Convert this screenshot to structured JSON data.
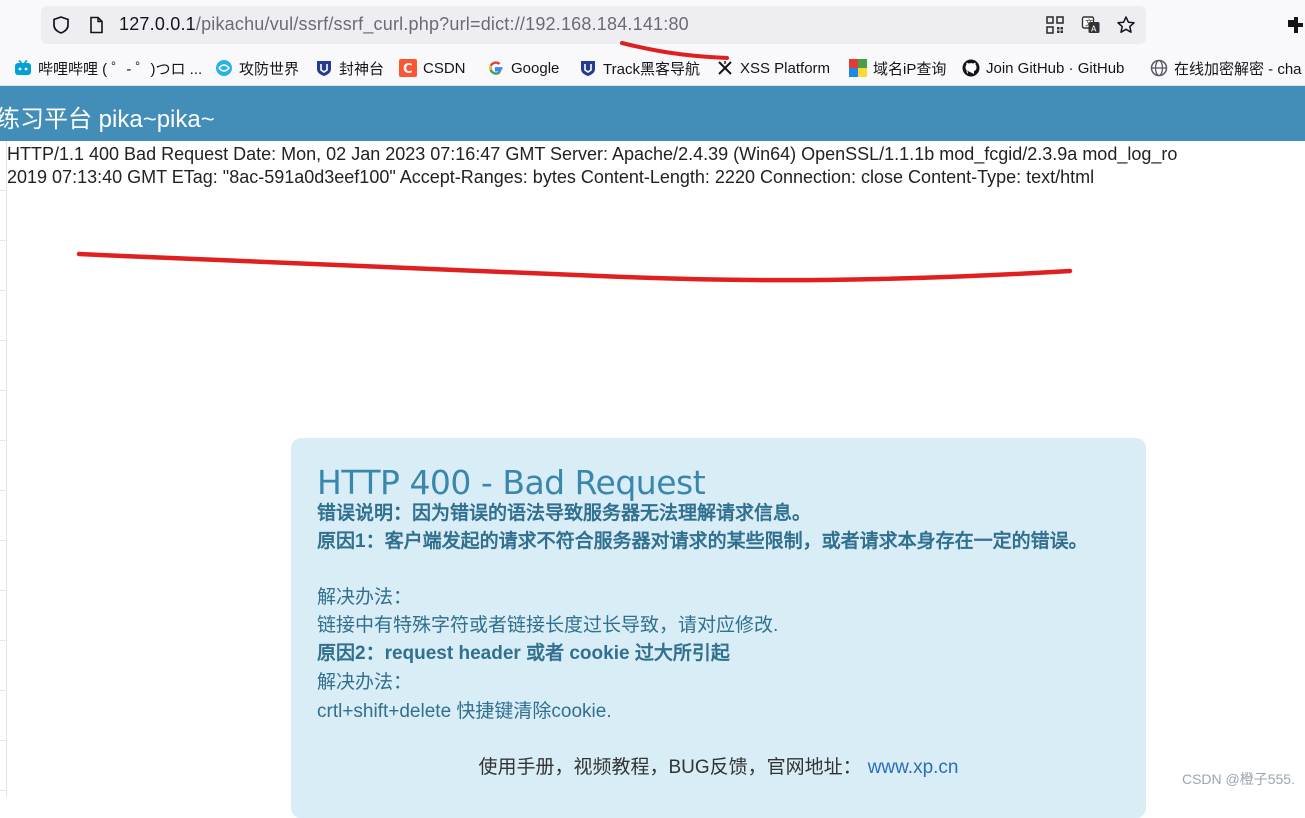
{
  "browser": {
    "url_host": "127.0.0.1",
    "url_path": "/pikachu/vul/ssrf/ssrf_curl.php?url=dict://192.168.184.141:80",
    "bookmarks": [
      {
        "label": "哔哩哔哩 ( ゜- ゜)つロ ...",
        "icon": "bilibili-icon",
        "color": "#00a1d6"
      },
      {
        "label": "攻防世界",
        "icon": "gongfang-icon",
        "color": "#1e90ff"
      },
      {
        "label": "封神台",
        "icon": "fengshen-icon",
        "color": "#1e3a8a"
      },
      {
        "label": "CSDN",
        "icon": "csdn-icon",
        "color": "#fc5531"
      },
      {
        "label": "Google",
        "icon": "google-icon",
        "color": "#4285f4"
      },
      {
        "label": "Track黑客导航",
        "icon": "track-icon",
        "color": "#1e3a8a"
      },
      {
        "label": "XSS Platform",
        "icon": "xss-icon",
        "color": "#15141a"
      },
      {
        "label": "域名iP查询",
        "icon": "domain-ip-icon",
        "color": "#4caf50"
      },
      {
        "label": "Join GitHub · GitHub",
        "icon": "github-icon",
        "color": "#15141a"
      },
      {
        "label": "在线加密解密 - cha",
        "icon": "globe-icon",
        "color": "#5b5b66"
      }
    ]
  },
  "header": {
    "title": "练习平台 pika~pika~"
  },
  "response": {
    "line1": "HTTP/1.1 400 Bad Request Date: Mon, 02 Jan 2023 07:16:47 GMT Server: Apache/2.4.39 (Win64) OpenSSL/1.1.1b mod_fcgid/2.3.9a mod_log_ro",
    "line2": "2019 07:13:40 GMT ETag: \"8ac-591a0d3eef100\" Accept-Ranges: bytes Content-Length: 2220 Connection: close Content-Type: text/html"
  },
  "error_box": {
    "title": "HTTP 400 - Bad Request",
    "description": "错误说明：因为错误的语法导致服务器无法理解请求信息。",
    "reason1": "原因1：客户端发起的请求不符合服务器对请求的某些限制，或者请求本身存在一定的错误。",
    "solution_label_1": "解决办法：",
    "solution1": "链接中有特殊字符或者链接长度过长导致，请对应修改.",
    "reason2": "原因2：request header 或者 cookie 过大所引起",
    "solution_label_2": "解决办法：",
    "solution2": "crtl+shift+delete 快捷键清除cookie.",
    "footer_text": "使用手册，视频教程，BUG反馈，官网地址：",
    "footer_link": "www.xp.cn"
  },
  "watermark": "CSDN @橙子555.",
  "colors": {
    "header_bg": "#438eb9",
    "error_box_bg": "#d9edf7",
    "error_title": "#3a87ad",
    "annotation_red": "#e02020"
  }
}
